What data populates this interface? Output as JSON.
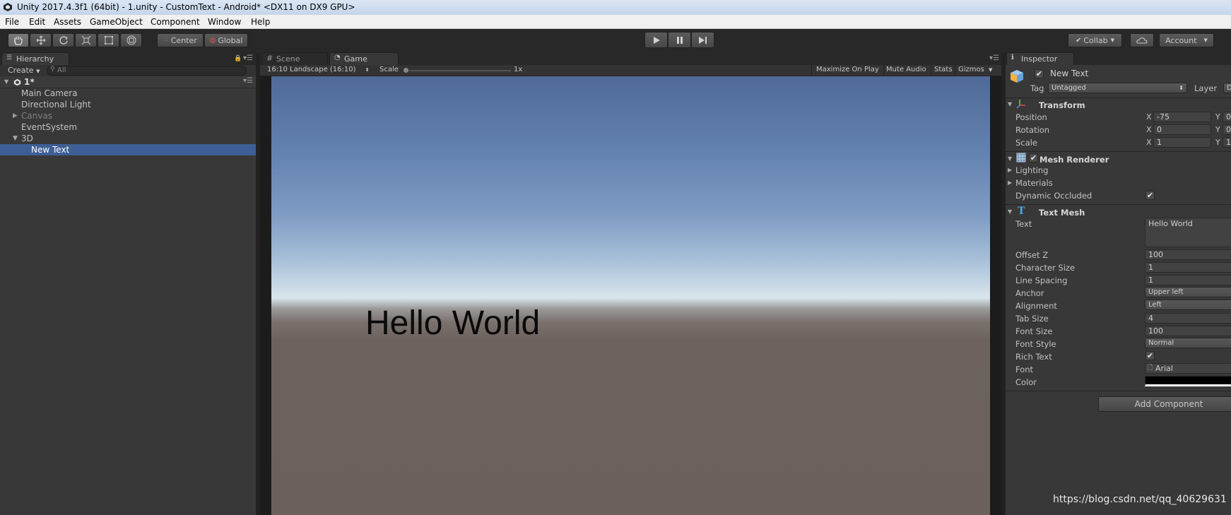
{
  "window": {
    "title": "Unity 2017.4.3f1 (64bit) - 1.unity - CustomText - Android* <DX11 on DX9 GPU>"
  },
  "menu": [
    "File",
    "Edit",
    "Assets",
    "GameObject",
    "Component",
    "Window",
    "Help"
  ],
  "toolbar": {
    "pivot_label": "Center",
    "space_label": "Global",
    "collab_label": "Collab",
    "account_label": "Account"
  },
  "hierarchy": {
    "tab_label": "Hierarchy",
    "create_label": "Create",
    "search_placeholder": "All",
    "scene_name": "1*",
    "items": [
      {
        "label": "Main Camera"
      },
      {
        "label": "Directional Light"
      },
      {
        "label": "Canvas"
      },
      {
        "label": "EventSystem"
      },
      {
        "label": "3D"
      },
      {
        "label": "New Text"
      }
    ]
  },
  "game_view": {
    "tabs": [
      "Scene",
      "Game"
    ],
    "aspect_label": "16:10 Landscape (16:10)",
    "scale_label": "Scale",
    "scale_value": "1x",
    "options": [
      "Maximize On Play",
      "Mute Audio",
      "Stats",
      "Gizmos"
    ],
    "rendered_text": "Hello World"
  },
  "inspector": {
    "tab_label": "Inspector",
    "object_name": "New Text",
    "tag_label": "Tag",
    "tag_value": "Untagged",
    "layer_label": "Layer",
    "layer_value": "D",
    "transform": {
      "title": "Transform",
      "position_label": "Position",
      "rotation_label": "Rotation",
      "scale_label": "Scale",
      "x_label": "X",
      "y_label": "Y",
      "position_x": "-75",
      "position_y": "0",
      "rotation_x": "0",
      "rotation_y": "0",
      "scale_x": "1",
      "scale_y": "1"
    },
    "mesh_renderer": {
      "title": "Mesh Renderer",
      "lighting_label": "Lighting",
      "materials_label": "Materials",
      "dynamic_occluded_label": "Dynamic Occluded"
    },
    "text_mesh": {
      "title": "Text Mesh",
      "fields": {
        "text_label": "Text",
        "text_value": "Hello World",
        "offset_z_label": "Offset Z",
        "offset_z": "100",
        "character_size_label": "Character Size",
        "character_size": "1",
        "line_spacing_label": "Line Spacing",
        "line_spacing": "1",
        "anchor_label": "Anchor",
        "anchor": "Upper left",
        "alignment_label": "Alignment",
        "alignment": "Left",
        "tab_size_label": "Tab Size",
        "tab_size": "4",
        "font_size_label": "Font Size",
        "font_size": "100",
        "font_style_label": "Font Style",
        "font_style": "Normal",
        "rich_text_label": "Rich Text",
        "font_label": "Font",
        "font": "Arial",
        "color_label": "Color"
      }
    },
    "add_component_label": "Add Component"
  },
  "watermark": "https://blog.csdn.net/qq_40629631",
  "colors": {
    "selection": "#3e5f96",
    "panel_bg": "#383838",
    "toolbar_bg": "#282828",
    "text_color_swatch": "#000000"
  }
}
